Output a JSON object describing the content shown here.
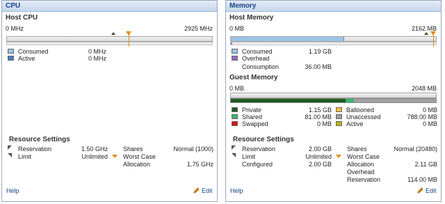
{
  "cpu": {
    "title": "CPU",
    "host_title": "Host CPU",
    "scale_min": "0 MHz",
    "scale_max": "2925 MHz",
    "legend": [
      {
        "label": "Consumed",
        "value": "0 MHz",
        "color": "#9dc3e6"
      },
      {
        "label": "Active",
        "value": "0 MHz",
        "color": "#4a7dbb"
      }
    ],
    "resource_settings": {
      "title": "Resource Settings",
      "reservation_label": "Reservation",
      "reservation_value": "1.50 GHz",
      "limit_label": "Limit",
      "limit_value": "Unlimited",
      "shares_label": "Shares",
      "shares_value": "Normal (1000)",
      "worst_case_label": "Worst Case",
      "allocation_label": "Allocation",
      "allocation_value": "1.75 GHz"
    },
    "help": "Help",
    "edit": "Edit"
  },
  "memory": {
    "title": "Memory",
    "host_title": "Host Memory",
    "host_scale_min": "0 MB",
    "host_scale_max": "2162 MB",
    "host_consumed_fraction": 0.55,
    "host_legend": [
      {
        "label": "Consumed",
        "value": "1.19 GB",
        "color": "#9dc3e6"
      },
      {
        "label": "Overhead",
        "value": "",
        "color": "#9b6bc4"
      },
      {
        "label": "Consumption",
        "value": "36.00 MB",
        "color": ""
      }
    ],
    "guest_title": "Guest Memory",
    "guest_scale_min": "0 MB",
    "guest_scale_max": "2048 MB",
    "guest_private_fraction": 0.56,
    "guest_shared_fraction": 0.04,
    "guest_legend_left": [
      {
        "label": "Private",
        "value": "1.15 GB",
        "color": "#1e5c1e"
      },
      {
        "label": "Shared",
        "value": "81.00 MB",
        "color": "#3cb371"
      },
      {
        "label": "Swapped",
        "value": "0 MB",
        "color": "#e01010"
      }
    ],
    "guest_legend_right": [
      {
        "label": "Ballooned",
        "value": "0 MB",
        "color": "#f1c232"
      },
      {
        "label": "Unaccessed",
        "value": "788.00 MB",
        "color": "#a0a0a0"
      },
      {
        "label": "Active",
        "value": "0 MB",
        "color": "#b5b520"
      }
    ],
    "resource_settings": {
      "title": "Resource Settings",
      "reservation_label": "Reservation",
      "reservation_value": "2.00 GB",
      "limit_label": "Limit",
      "limit_value": "Unlimited",
      "configured_label": "Configured",
      "configured_value": "2.00 GB",
      "shares_label": "Shares",
      "shares_value": "Normal (20480)",
      "worst_case_label": "Worst Case",
      "allocation_label": "Allocation",
      "allocation_value": "2.11 GB",
      "overhead_label": "Overhead",
      "overhead_reservation_label": "Reservation",
      "overhead_reservation_value": "114.00 MB"
    },
    "help": "Help",
    "edit": "Edit"
  }
}
